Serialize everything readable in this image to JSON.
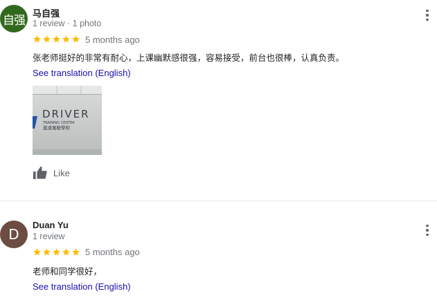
{
  "reviews": [
    {
      "avatar_text": "自强",
      "avatar_color": "#33691e",
      "name": "马自强",
      "meta": "1 review · 1 photo",
      "rating": 5,
      "time_ago": "5 months ago",
      "text": "张老师挺好的非常有耐心，上课幽默感很强，容易接受，前台也很棒，认真负责。",
      "translation_link": "See translation (English)",
      "photo": {
        "sign_line1": "DRIVER",
        "sign_line2": "TRAINING CENTER",
        "sign_line3": "進達駕駛學校"
      },
      "like_label": "Like"
    },
    {
      "avatar_text": "D",
      "avatar_color": "#6d4c41",
      "name": "Duan Yu",
      "meta": "1 review",
      "rating": 5,
      "time_ago": "5 months ago",
      "text": "老师和同学很好，",
      "translation_link": "See translation (English)"
    }
  ],
  "icons": {
    "star": "star-icon",
    "more": "more-vert-icon",
    "like": "thumb-up-icon"
  },
  "colors": {
    "star": "#fbbc04",
    "link": "#1a0dab",
    "muted": "#70757a"
  }
}
